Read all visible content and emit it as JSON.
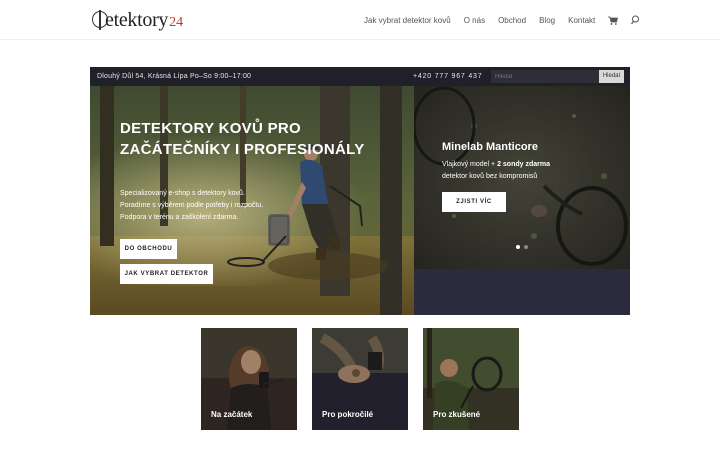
{
  "brand": {
    "logo_text": "etektory",
    "logo_number": "24",
    "accent": "#c0392b"
  },
  "nav": {
    "items": [
      "Jak vybrat detektor kovů",
      "O nás",
      "Obchod",
      "Blog",
      "Kontakt"
    ],
    "cart_icon": "cart-icon",
    "search_icon": "search-icon"
  },
  "topbar": {
    "address": "Dlouhý Důl 54, Krásná Lípa   Po–So 9:00–17:00",
    "phone": "+420 777 967 437",
    "search_placeholder": "Hledat",
    "search_button": "Hledat"
  },
  "hero": {
    "title": "DETEKTORY KOVŮ PRO ZAČÁTEČNÍKY I PROFESIONÁLY",
    "text_lines": [
      "Specializovaný e-shop s detektory kovů.",
      "Poradíme s výběrem podle potřeby i rozpočtu.",
      "Podpora v terénu a zaškolení zdarma."
    ],
    "btn_shop": "DO OBCHODU",
    "btn_guide": "JAK VYBRAT DETEKTOR"
  },
  "slide": {
    "title": "Minelab Manticore",
    "line1_prefix": "Vlajkový model + ",
    "line1_bold": "2 sondy zdarma",
    "line2": "detektor kovů bez kompromisů",
    "button": "ZJISTI VÍC",
    "dots": {
      "count": 2,
      "active": 1
    }
  },
  "categories": [
    {
      "label": "Na začátek"
    },
    {
      "label": "Pro pokročilé"
    },
    {
      "label": "Pro zkušené"
    }
  ],
  "colors": {
    "topbar": "#1f2028",
    "slide_bg": "#2a2b3c"
  }
}
